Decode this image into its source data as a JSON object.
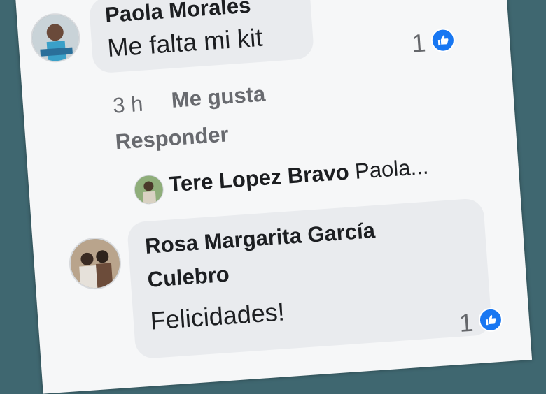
{
  "comments": [
    {
      "author": "Paola Morales",
      "text": "Me falta mi kit",
      "likes": "1",
      "time": "3 h",
      "like_action": "Me gusta",
      "reply_action": "Responder",
      "reply_preview": {
        "author": "Tere Lopez Bravo",
        "snippet": "Paola..."
      }
    },
    {
      "author_line1": "Rosa Margarita García",
      "author_line2": "Culebro",
      "text": "Felicidades!",
      "likes": "1"
    }
  ]
}
